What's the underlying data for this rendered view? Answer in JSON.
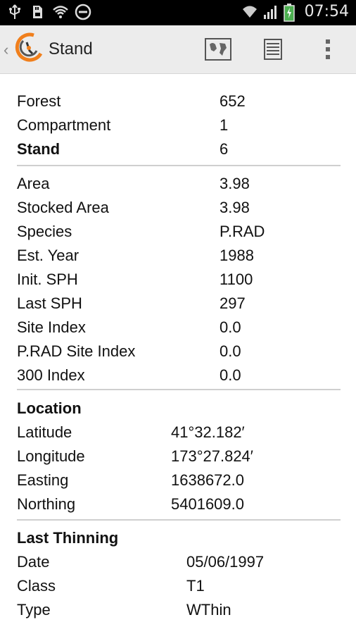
{
  "status_bar": {
    "time": "07:54",
    "icons": [
      "usb-icon",
      "sd-card-icon",
      "wifi-icon",
      "do-not-disturb-icon",
      "wifi-signal-icon",
      "cell-signal-icon",
      "battery-charging-icon"
    ]
  },
  "action_bar": {
    "title": "Stand",
    "buttons": [
      "map-icon",
      "list-icon",
      "overflow-menu-icon"
    ]
  },
  "stand": {
    "forest_label": "Forest",
    "forest_value": "652",
    "compartment_label": "Compartment",
    "compartment_value": "1",
    "stand_label": "Stand",
    "stand_value": "6"
  },
  "details": {
    "area_label": "Area",
    "area_value": "3.98",
    "stocked_area_label": "Stocked Area",
    "stocked_area_value": "3.98",
    "species_label": "Species",
    "species_value": "P.RAD",
    "est_year_label": "Est. Year",
    "est_year_value": "1988",
    "init_sph_label": "Init. SPH",
    "init_sph_value": "1100",
    "last_sph_label": "Last SPH",
    "last_sph_value": "297",
    "site_index_label": "Site Index",
    "site_index_value": "0.0",
    "prad_site_index_label": "P.RAD Site Index",
    "prad_site_index_value": "0.0",
    "index_300_label": "300 Index",
    "index_300_value": "0.0"
  },
  "location": {
    "heading": "Location",
    "latitude_label": "Latitude",
    "latitude_value": "41°32.182′",
    "longitude_label": "Longitude",
    "longitude_value": "173°27.824′",
    "easting_label": "Easting",
    "easting_value": "1638672.0",
    "northing_label": "Northing",
    "northing_value": "5401609.0"
  },
  "last_thinning": {
    "heading": "Last Thinning",
    "date_label": "Date",
    "date_value": "05/06/1997",
    "class_label": "Class",
    "class_value": "T1",
    "type_label": "Type",
    "type_value": "WThin"
  }
}
